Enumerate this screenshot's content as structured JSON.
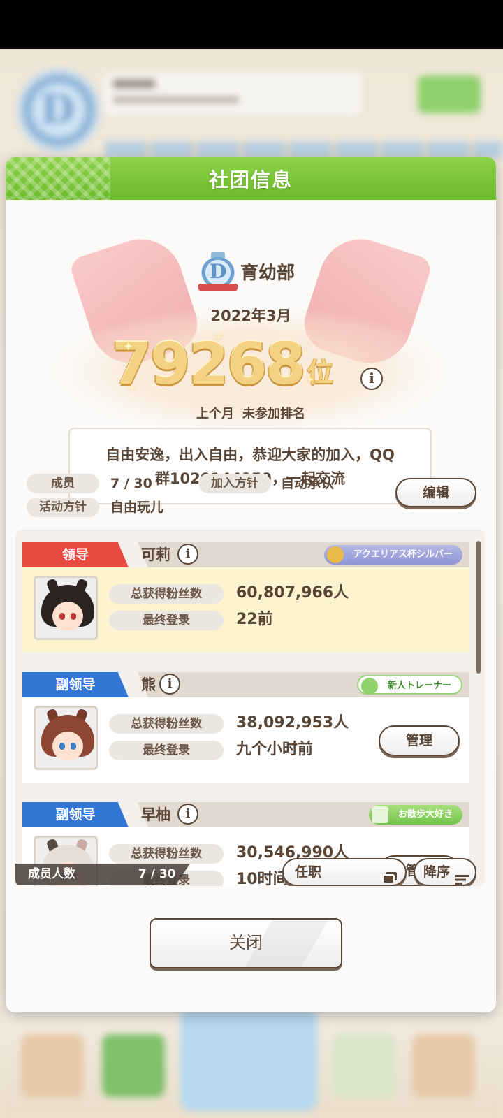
{
  "modal": {
    "title": "社团信息",
    "club_name": "育幼部",
    "rank_date": "2022年3月",
    "rank_number": "79268",
    "rank_unit": "位",
    "info_glyph": "i",
    "last_month_label": "上个月",
    "last_month_value": "未参加排名",
    "description_line1": "自由安逸，出入自由，恭迎大家的加入，QQ",
    "description_line2": "群1020144959，一起交流",
    "members_label": "成员",
    "members_value": "7 / 30",
    "join_policy_label": "加入方针",
    "join_policy_value": "自动承认",
    "activity_policy_label": "活动方针",
    "activity_policy_value": "自由玩儿",
    "edit_label": "编辑",
    "close_label": "关闭"
  },
  "member_list": {
    "fans_label": "总获得粉丝数",
    "login_label": "最终登录",
    "manage_label": "管理",
    "members": [
      {
        "role": "领导",
        "name": "可莉",
        "title": "アクエリアス杯シルバー",
        "fans": "60,807,966人",
        "last_login": "22前"
      },
      {
        "role": "副领导",
        "name": "熊",
        "title": "新人トレーナー",
        "fans": "38,092,953人",
        "last_login": "九个小时前"
      },
      {
        "role": "副领导",
        "name": "早柚",
        "title": "お散歩大好き",
        "fans": "30,546,990人",
        "last_login": "10时间"
      }
    ],
    "member_count_label": "成员人数",
    "member_count_value": "7 / 30",
    "filter_label": "任职",
    "sort_label": "降序"
  },
  "colors": {
    "header_green": "#7cc83a",
    "leader_red": "#e84a3f",
    "subleader_blue": "#3476d6",
    "rank_gold": "#f3d383",
    "text_brown": "#5a4636"
  }
}
